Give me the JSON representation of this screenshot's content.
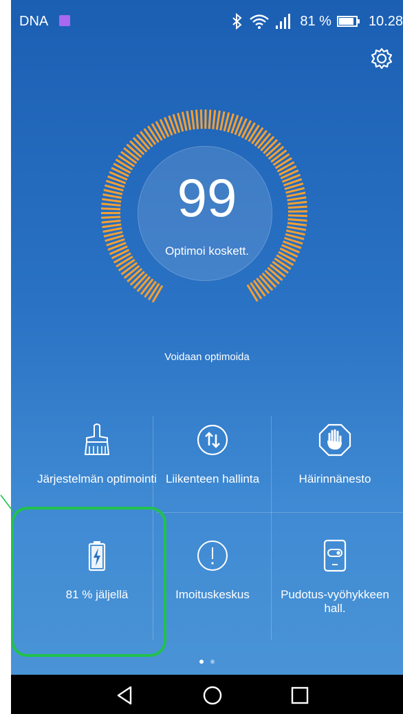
{
  "statusbar": {
    "carrier": "DNA",
    "battery_percent": "81 %",
    "time": "10.28"
  },
  "gauge": {
    "score": "99",
    "action_label": "Optimoi koskett.",
    "hint": "Voidaan optimoida",
    "accent_color": "#f5a031"
  },
  "tiles": [
    {
      "label": "Järjestelmän optimointi",
      "icon": "broom-icon"
    },
    {
      "label": "Liikenteen hallinta",
      "icon": "traffic-icon"
    },
    {
      "label": "Häirinnänesto",
      "icon": "hand-icon"
    },
    {
      "label": "81 % jäljellä",
      "icon": "battery-icon"
    },
    {
      "label": "Imoituskeskus",
      "icon": "notification-icon"
    },
    {
      "label": "Pudotus-vyöhykkeen hall.",
      "icon": "dropzone-icon"
    }
  ],
  "pager": {
    "active_page": 1,
    "page_count": 2
  },
  "colors": {
    "highlight": "#21c24d",
    "background_top": "#1b5fb3",
    "background_bottom": "#4a93d6"
  }
}
